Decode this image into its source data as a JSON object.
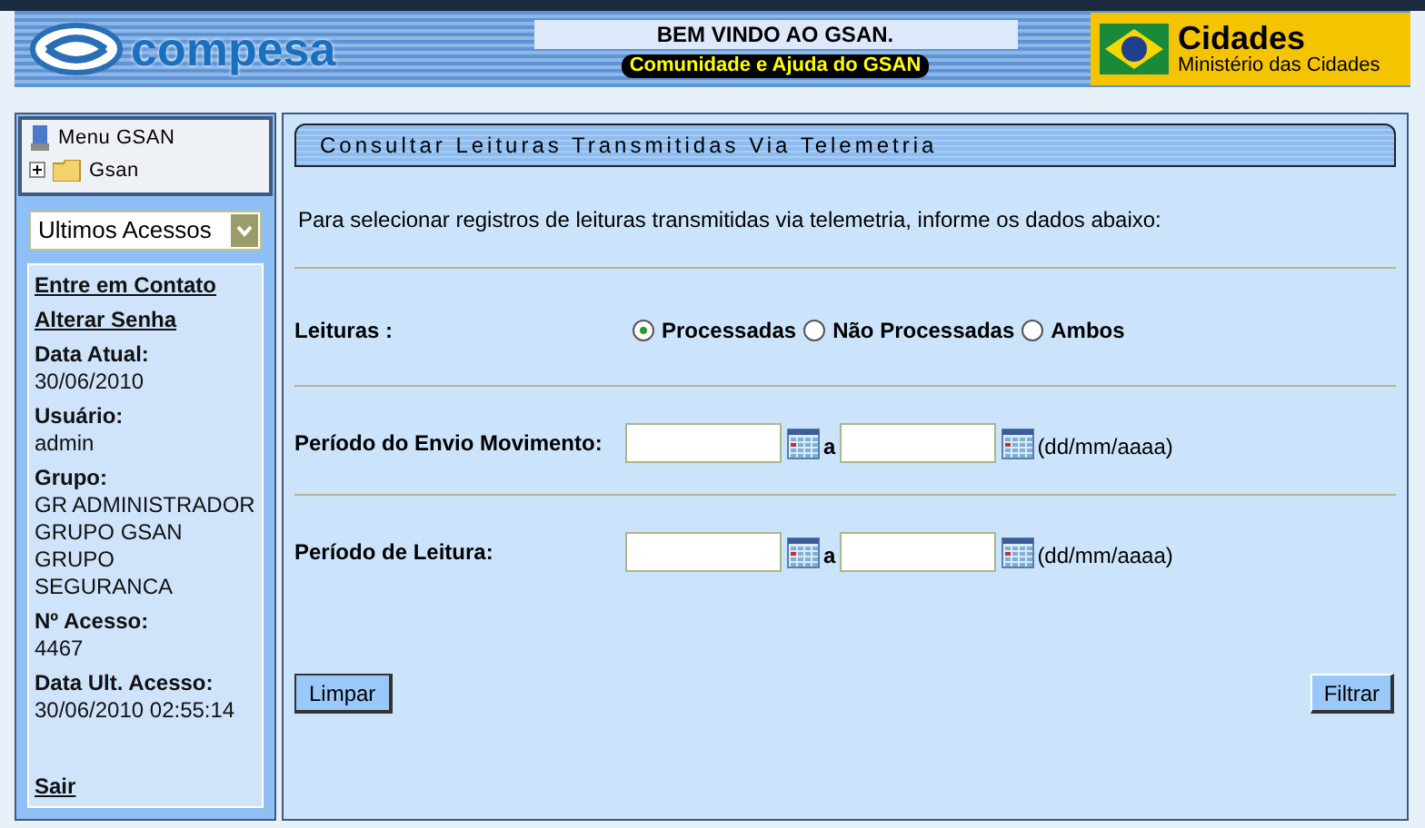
{
  "header": {
    "logo": "compesa",
    "welcome": "BEM VINDO AO GSAN.",
    "community_link": "Comunidade e Ajuda do GSAN",
    "ministry": {
      "title": "Cidades",
      "subtitle": "Ministério das Cidades"
    }
  },
  "sidebar": {
    "menu_title": "Menu GSAN",
    "tree": [
      {
        "label": "Gsan",
        "expanded": false
      }
    ],
    "recent_select": "Ultimos Acessos",
    "links": [
      "Entre em Contato",
      "Alterar Senha"
    ],
    "info": [
      {
        "label": "Data Atual:",
        "lines": [
          "30/06/2010"
        ]
      },
      {
        "label": "Usuário:",
        "lines": [
          "admin"
        ]
      },
      {
        "label": "Grupo:",
        "lines": [
          "GR ADMINISTRADOR",
          "GRUPO GSAN",
          "GRUPO",
          "SEGURANCA"
        ]
      },
      {
        "label": "Nº Acesso:",
        "lines": [
          "4467"
        ]
      },
      {
        "label": "Data Ult. Acesso:",
        "lines": [
          "30/06/2010 02:55:14"
        ]
      }
    ],
    "logout": "Sair"
  },
  "form": {
    "title": "Consultar Leituras Transmitidas Via Telemetria",
    "intro": "Para selecionar registros de leituras transmitidas via telemetria, informe os dados abaixo:",
    "readings": {
      "label": "Leituras :",
      "options": [
        {
          "label": "Processadas",
          "selected": true
        },
        {
          "label": "Não Processadas",
          "selected": false
        },
        {
          "label": "Ambos",
          "selected": false
        }
      ]
    },
    "periods": [
      {
        "label": "Período do Envio Movimento:",
        "separator": "a",
        "hint": "(dd/mm/aaaa)"
      },
      {
        "label": "Período de Leitura:",
        "separator": "a",
        "hint": "(dd/mm/aaaa)"
      }
    ],
    "buttons": {
      "clear": "Limpar",
      "filter": "Filtrar"
    }
  }
}
